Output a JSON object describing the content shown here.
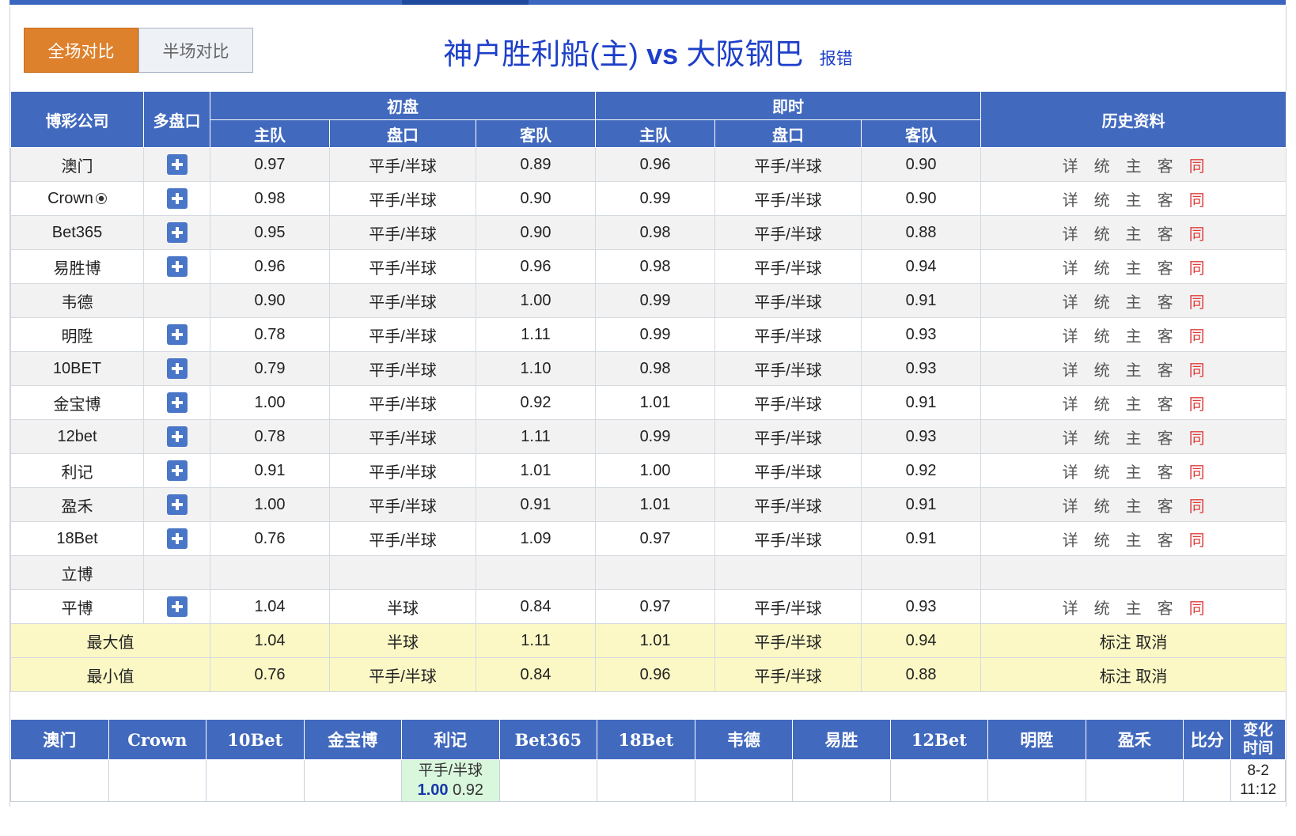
{
  "tabs": {
    "full": "全场对比",
    "half": "半场对比"
  },
  "match": {
    "home": "神户胜利船(主)",
    "vs": "vs",
    "away": "大阪钢巴",
    "report": "报错"
  },
  "headers": {
    "company": "博彩公司",
    "multi": "多盘口",
    "initial": "初盘",
    "live": "即时",
    "history": "历史资料",
    "home": "主队",
    "line": "盘口",
    "away": "客队"
  },
  "history_links": [
    "详",
    "统",
    "主",
    "客",
    "同"
  ],
  "rows": [
    {
      "name": "澳门",
      "plus": true,
      "ih": "0.97",
      "il": "平手/半球",
      "ia": "0.89",
      "lh": "0.96",
      "ll": "平手/半球",
      "la": "0.90",
      "hist": true
    },
    {
      "name": "Crown",
      "ball": true,
      "plus": true,
      "ih": "0.98",
      "il": "平手/半球",
      "ia": "0.90",
      "lh": "0.99",
      "ll": "平手/半球",
      "la": "0.90",
      "hist": true
    },
    {
      "name": "Bet365",
      "plus": true,
      "ih": "0.95",
      "il": "平手/半球",
      "ia": "0.90",
      "lh": "0.98",
      "ll": "平手/半球",
      "la": "0.88",
      "hist": true
    },
    {
      "name": "易胜博",
      "plus": true,
      "ih": "0.96",
      "il": "平手/半球",
      "ia": "0.96",
      "lh": "0.98",
      "ll": "平手/半球",
      "la": "0.94",
      "hist": true
    },
    {
      "name": "韦德",
      "plus": false,
      "ih": "0.90",
      "il": "平手/半球",
      "ia": "1.00",
      "lh": "0.99",
      "ll": "平手/半球",
      "la": "0.91",
      "hist": true
    },
    {
      "name": "明陞",
      "plus": true,
      "ih": "0.78",
      "il": "平手/半球",
      "ia": "1.11",
      "lh": "0.99",
      "ll": "平手/半球",
      "la": "0.93",
      "hist": true
    },
    {
      "name": "10BET",
      "plus": true,
      "ih": "0.79",
      "il": "平手/半球",
      "ia": "1.10",
      "lh": "0.98",
      "ll": "平手/半球",
      "la": "0.93",
      "hist": true
    },
    {
      "name": "金宝博",
      "plus": true,
      "ih": "1.00",
      "il": "平手/半球",
      "ia": "0.92",
      "lh": "1.01",
      "ll": "平手/半球",
      "la": "0.91",
      "hist": true
    },
    {
      "name": "12bet",
      "plus": true,
      "ih": "0.78",
      "il": "平手/半球",
      "ia": "1.11",
      "lh": "0.99",
      "ll": "平手/半球",
      "la": "0.93",
      "hist": true
    },
    {
      "name": "利记",
      "plus": true,
      "ih": "0.91",
      "il": "平手/半球",
      "ia": "1.01",
      "lh": "1.00",
      "ll": "平手/半球",
      "la": "0.92",
      "hist": true
    },
    {
      "name": "盈禾",
      "plus": true,
      "ih": "1.00",
      "il": "平手/半球",
      "ia": "0.91",
      "lh": "1.01",
      "ll": "平手/半球",
      "la": "0.91",
      "hist": true
    },
    {
      "name": "18Bet",
      "plus": true,
      "ih": "0.76",
      "il": "平手/半球",
      "ia": "1.09",
      "lh": "0.97",
      "ll": "平手/半球",
      "la": "0.91",
      "hist": true
    },
    {
      "name": "立博",
      "plus": false,
      "ih": "",
      "il": "",
      "ia": "",
      "lh": "",
      "ll": "",
      "la": "",
      "hist": false
    },
    {
      "name": "平博",
      "plus": true,
      "ih": "1.04",
      "il": "半球",
      "ia": "0.84",
      "lh": "0.97",
      "ll": "平手/半球",
      "la": "0.93",
      "hist": true
    }
  ],
  "stats": [
    {
      "label": "最大值",
      "ih": "1.04",
      "il": "半球",
      "ia": "1.11",
      "lh": "1.01",
      "ll": "平手/半球",
      "la": "0.94",
      "mark": "标注 取消"
    },
    {
      "label": "最小值",
      "ih": "0.76",
      "il": "平手/半球",
      "ia": "0.84",
      "lh": "0.96",
      "ll": "平手/半球",
      "la": "0.88",
      "mark": "标注 取消"
    }
  ],
  "change_table": {
    "headers": [
      "澳门",
      "Crown",
      "10Bet",
      "金宝博",
      "利记",
      "Bet365",
      "18Bet",
      "韦德",
      "易胜",
      "12Bet",
      "明陞",
      "盈禾",
      "比分",
      "变化时间"
    ],
    "time_header_lines": [
      "变化",
      "时间"
    ],
    "row": {
      "lj_line": "平手/半球",
      "lj_home": "1.00",
      "lj_away": "0.92",
      "time_date": "8-2",
      "time_clock": "11:12"
    }
  }
}
